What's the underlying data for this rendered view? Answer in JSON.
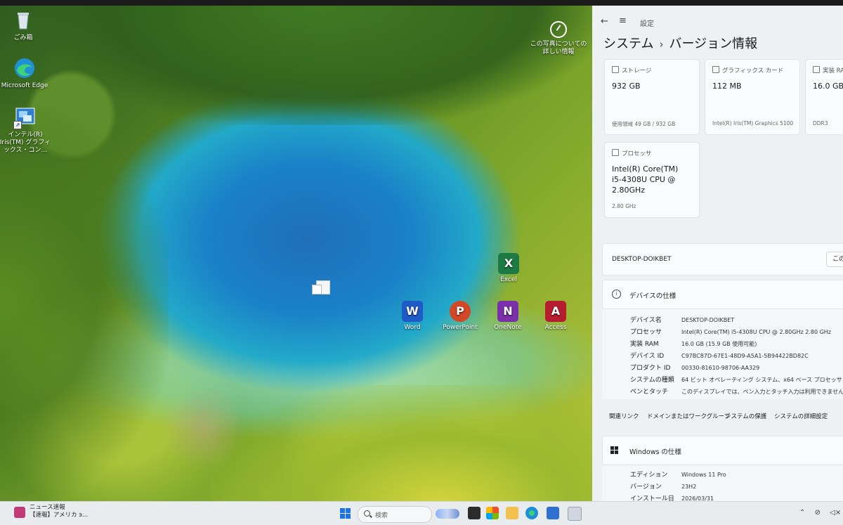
{
  "desktop": {
    "icons": [
      {
        "label": "ごみ箱"
      },
      {
        "label": "Microsoft Edge"
      },
      {
        "label": "インテル(R) Iris(TM) グラフィックス・コン..."
      }
    ],
    "photo_info": {
      "line1": "この写真について",
      "line2": "の",
      "line3": "詳しい情報"
    },
    "apps": [
      {
        "label": "Excel",
        "letter": "X",
        "color": "#1d7a45"
      },
      {
        "label": "Word",
        "letter": "W",
        "color": "#1e5bc6"
      },
      {
        "label": "PowerPoint",
        "letter": "P",
        "color": "#d24726"
      },
      {
        "label": "OneNote",
        "letter": "N",
        "color": "#7b2fa8"
      },
      {
        "label": "Access",
        "letter": "A",
        "color": "#b51e2e"
      }
    ]
  },
  "settings": {
    "window_title": "設定",
    "breadcrumb": {
      "parent": "システム",
      "current": "バージョン情報"
    },
    "cards": {
      "storage": {
        "label": "ストレージ",
        "value": "932 GB",
        "sub": "使用領域 49 GB / 932 GB"
      },
      "gpu": {
        "label": "グラフィックス カード",
        "value": "112 MB",
        "sub": "Intel(R) Iris(TM) Graphics 5100"
      },
      "ram": {
        "label": "実装 RA",
        "value": "16.0 GB",
        "sub": "DDR3"
      },
      "cpu": {
        "label": "プロセッサ",
        "line1": "Intel(R) Core(TM)",
        "line2": "i5-4308U CPU @",
        "line3": "2.80GHz",
        "sub": "2.80 GHz"
      }
    },
    "device_name": "DESKTOP-DOIKBET",
    "rename_button": "この",
    "device_spec": {
      "title": "デバイスの仕様",
      "rows": [
        {
          "k": "デバイス名",
          "v": "DESKTOP-DOIKBET"
        },
        {
          "k": "プロセッサ",
          "v": "Intel(R) Core(TM) i5-4308U CPU @ 2.80GHz   2.80 GHz"
        },
        {
          "k": "実装 RAM",
          "v": "16.0 GB (15.9 GB 使用可能)"
        },
        {
          "k": "デバイス ID",
          "v": "C97BC87D-67E1-48D9-A5A1-5B94422BD82C"
        },
        {
          "k": "プロダクト ID",
          "v": "00330-81610-98706-AA329"
        },
        {
          "k": "システムの種類",
          "v": "64 ビット オペレーティング システム、x64 ベース プロセッサ"
        },
        {
          "k": "ペンとタッチ",
          "v": "このディスプレイでは、ペン入力とタッチ入力は利用できません"
        }
      ]
    },
    "related_links": {
      "label": "関連リンク",
      "items": [
        "ドメインまたはワークグループ",
        "システムの保護",
        "システムの詳細設定"
      ]
    },
    "windows_spec": {
      "title": "Windows の仕様",
      "rows": [
        {
          "k": "エディション",
          "v": "Windows 11 Pro"
        },
        {
          "k": "バージョン",
          "v": "23H2"
        },
        {
          "k": "インストール日",
          "v": "2026/03/31"
        }
      ]
    }
  },
  "taskbar": {
    "news_title": "ニュース速報",
    "news_sub": "【速報】アメリカ э...",
    "search_placeholder": "検索"
  }
}
